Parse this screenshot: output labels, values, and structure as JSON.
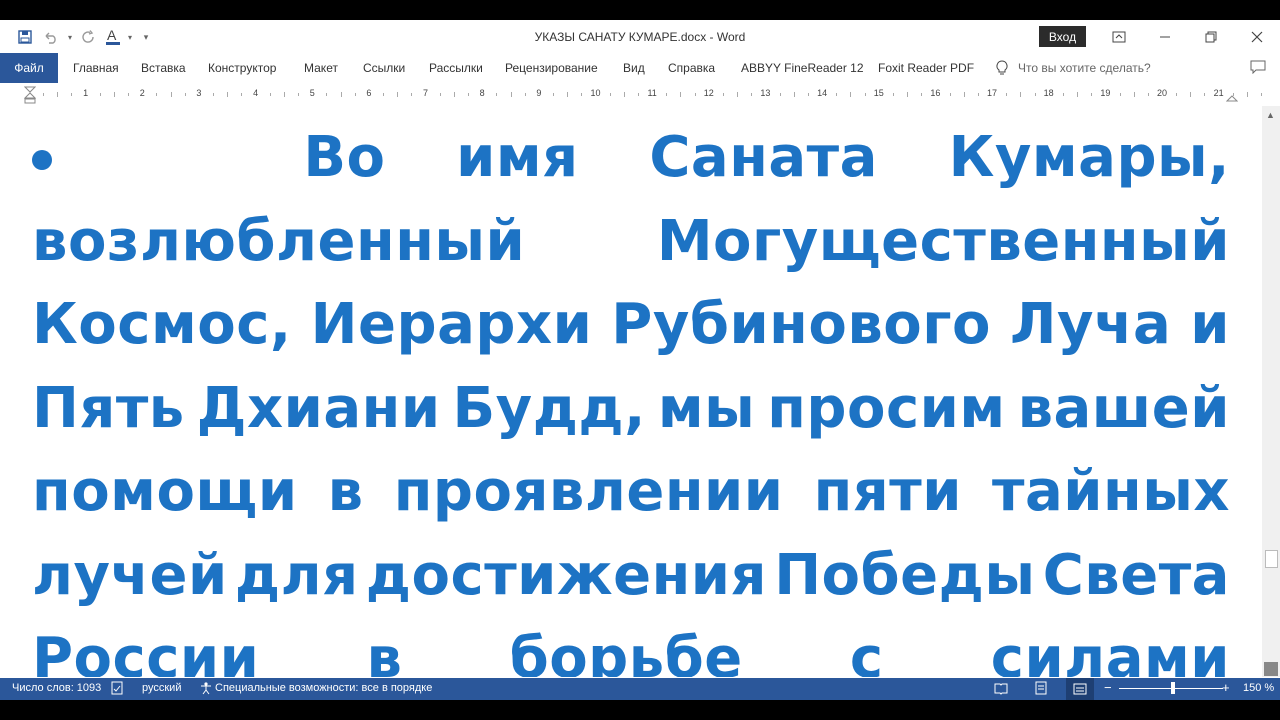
{
  "window": {
    "title": "УКАЗЫ САНАТУ КУМАРЕ.docx  -  Word",
    "sign_in": "Вход"
  },
  "quick_access": [
    "save-icon",
    "undo-icon",
    "redo-icon",
    "font-color-icon",
    "customize-icon"
  ],
  "ribbon": {
    "file_tab": "Файл",
    "tabs": [
      "Главная",
      "Вставка",
      "Конструктор",
      "Макет",
      "Ссылки",
      "Рассылки",
      "Рецензирование",
      "Вид",
      "Справка",
      "ABBYY FineReader 12",
      "Foxit Reader PDF"
    ],
    "tell_me": "Что вы хотите сделать?"
  },
  "ruler": {
    "numbers": [
      "1",
      "2",
      "3",
      "4",
      "5",
      "6",
      "7",
      "8",
      "9",
      "10",
      "11",
      "12",
      "13",
      "14",
      "15",
      "16",
      "17",
      "18",
      "19",
      "20",
      "21"
    ]
  },
  "document": {
    "lines": [
      [
        "Во",
        "имя",
        "Саната",
        "Кумары,"
      ],
      [
        "возлюбленный",
        "Могущественный"
      ],
      [
        "Космос,",
        "Иерархи",
        "Рубинового",
        "Луча",
        "и"
      ],
      [
        "Пять",
        "Дхиани",
        "Будд,",
        "мы",
        "просим",
        "вашей"
      ],
      [
        "помощи",
        "в",
        "проявлении",
        "пяти",
        "тайных"
      ],
      [
        "лучей",
        "для",
        "достижения",
        "Победы",
        "Света"
      ],
      [
        "России",
        "в",
        "борьбе",
        "с",
        "силами"
      ]
    ],
    "color": "#1d73c4"
  },
  "status": {
    "word_count": "Число слов: 1093",
    "language": "русский",
    "accessibility": "Специальные возможности: все в порядке",
    "zoom": "150 %"
  },
  "colors": {
    "accent": "#2b579a",
    "signin_bg": "#2b2b2b"
  }
}
